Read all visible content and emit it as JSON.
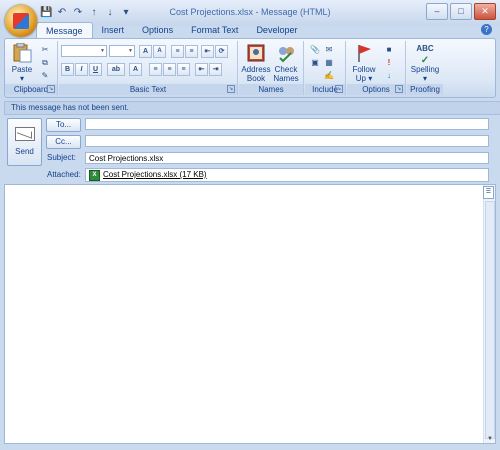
{
  "window": {
    "title": "Cost Projections.xlsx - Message (HTML)"
  },
  "tabs": [
    "Message",
    "Insert",
    "Options",
    "Format Text",
    "Developer"
  ],
  "ribbon": {
    "clipboard": {
      "label": "Clipboard",
      "paste": "Paste"
    },
    "basic_text": {
      "label": "Basic Text"
    },
    "names": {
      "label": "Names",
      "address_book": [
        "Address",
        "Book"
      ],
      "check_names": [
        "Check",
        "Names"
      ]
    },
    "include": {
      "label": "Include"
    },
    "options": {
      "label": "Options",
      "follow_up": [
        "Follow",
        "Up"
      ]
    },
    "proofing": {
      "label": "Proofing",
      "spelling": "Spelling",
      "spelling_icon_text": "ABC"
    }
  },
  "infobar": {
    "text": "This message has not been sent."
  },
  "compose": {
    "send": "Send",
    "to_button": "To...",
    "cc_button": "Cc...",
    "to_value": "",
    "cc_value": "",
    "subject_label": "Subject:",
    "subject_value": "Cost Projections.xlsx",
    "attached_label": "Attached:",
    "attachment": "Cost Projections.xlsx (17 KB)"
  }
}
